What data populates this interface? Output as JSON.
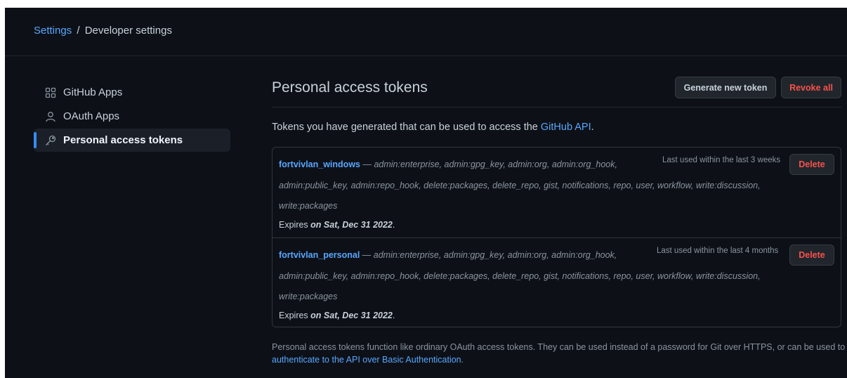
{
  "breadcrumb": {
    "settings": "Settings",
    "separator": "/",
    "current": "Developer settings"
  },
  "sidebar": {
    "items": [
      {
        "label": "GitHub Apps",
        "icon": "apps-grid-icon",
        "active": false
      },
      {
        "label": "OAuth Apps",
        "icon": "person-icon",
        "active": false
      },
      {
        "label": "Personal access tokens",
        "icon": "key-icon",
        "active": true
      }
    ]
  },
  "main": {
    "title": "Personal access tokens",
    "generate_button": "Generate new token",
    "revoke_button": "Revoke all",
    "intro_text": "Tokens you have generated that can be used to access the ",
    "intro_link": "GitHub API",
    "intro_end": ".",
    "tokens": [
      {
        "name": "fortvivlan_windows",
        "dash": " — ",
        "scopes_line1": "admin:enterprise, admin:gpg_key, admin:org, admin:org_hook,",
        "scopes_line2": "admin:public_key, admin:repo_hook, delete:packages, delete_repo, gist, notifications, repo, user, workflow, write:discussion,",
        "scopes_line3": "write:packages",
        "expires_prefix": "Expires ",
        "expires_date": "on Sat, Dec 31 2022",
        "expires_end": ".",
        "last_used": "Last used within the last 3 weeks",
        "delete_button": "Delete"
      },
      {
        "name": "fortvivlan_personal",
        "dash": " — ",
        "scopes_line1": "admin:enterprise, admin:gpg_key, admin:org, admin:org_hook,",
        "scopes_line2": "admin:public_key, admin:repo_hook, delete:packages, delete_repo, gist, notifications, repo, user, workflow, write:discussion,",
        "scopes_line3": "write:packages",
        "expires_prefix": "Expires ",
        "expires_date": "on Sat, Dec 31 2022",
        "expires_end": ".",
        "last_used": "Last used within the last 4 months",
        "delete_button": "Delete"
      }
    ],
    "footer_text": "Personal access tokens function like ordinary OAuth access tokens. They can be used instead of a password for Git over HTTPS, or can be used to ",
    "footer_link": "authenticate to the API over Basic Authentication",
    "footer_end": "."
  },
  "colors": {
    "background": "#0d1117",
    "link": "#58a6ff",
    "danger": "#f85149",
    "active_indicator": "#388bfd"
  }
}
